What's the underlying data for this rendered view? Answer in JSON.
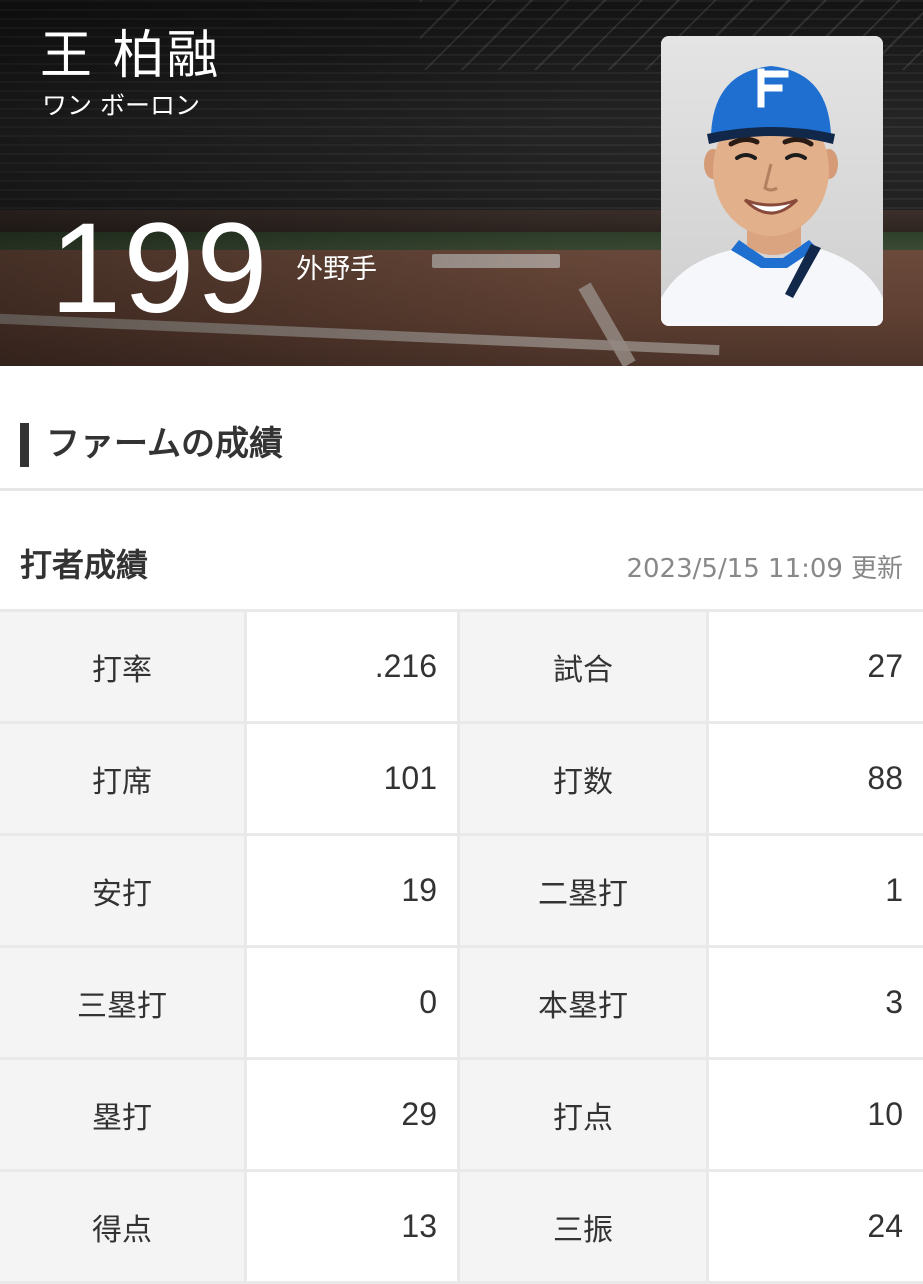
{
  "player": {
    "name": "王 柏融",
    "kana": "ワン ボーロン",
    "number": "199",
    "position": "外野手",
    "photo_icon": "player-photo"
  },
  "section": {
    "title": "ファームの成績"
  },
  "batting": {
    "title": "打者成績",
    "updated_datetime": "2023/5/15 11:09",
    "updated_suffix": "更新",
    "rows": [
      [
        {
          "label": "打率",
          "value": ".216"
        },
        {
          "label": "試合",
          "value": "27"
        }
      ],
      [
        {
          "label": "打席",
          "value": "101"
        },
        {
          "label": "打数",
          "value": "88"
        }
      ],
      [
        {
          "label": "安打",
          "value": "19"
        },
        {
          "label": "二塁打",
          "value": "1"
        }
      ],
      [
        {
          "label": "三塁打",
          "value": "0"
        },
        {
          "label": "本塁打",
          "value": "3"
        }
      ],
      [
        {
          "label": "塁打",
          "value": "29"
        },
        {
          "label": "打点",
          "value": "10"
        }
      ],
      [
        {
          "label": "得点",
          "value": "13"
        },
        {
          "label": "三振",
          "value": "24"
        }
      ]
    ]
  },
  "colors": {
    "cap_blue": "#1f6fd1",
    "label_bg": "#f4f4f4",
    "grid_border": "#e9e9e9",
    "text": "#333333",
    "muted_text": "#888888"
  }
}
